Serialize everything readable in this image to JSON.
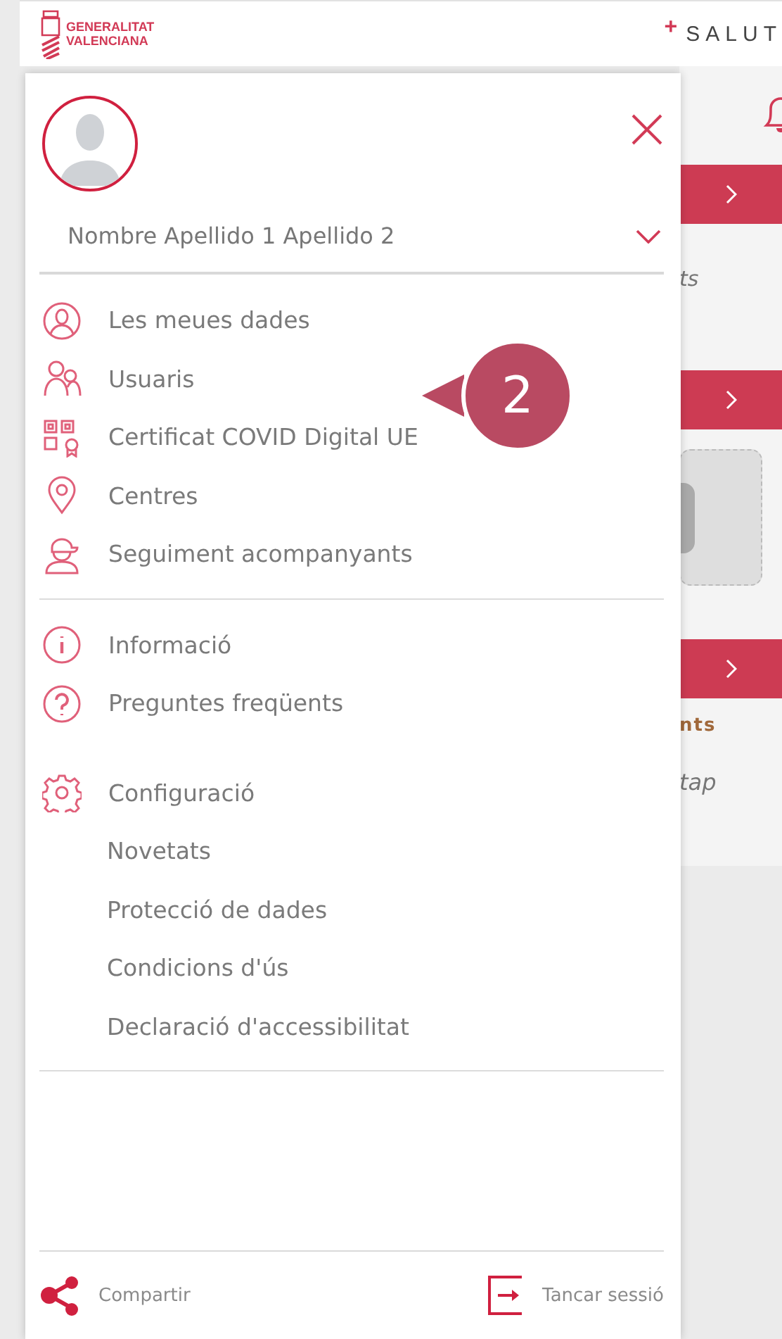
{
  "header": {
    "logo_lines": [
      "GENERALITAT",
      "VALENCIANA"
    ],
    "brand_mark": "+",
    "brand": "SALUT"
  },
  "background": [
    {
      "kind": "bar"
    },
    {
      "kind": "text",
      "text": "ts"
    },
    {
      "kind": "bar"
    },
    {
      "kind": "placeholder"
    },
    {
      "kind": "bar"
    },
    {
      "kind": "highlight",
      "text": "nts"
    },
    {
      "kind": "italic",
      "text": "tap"
    }
  ],
  "drawer": {
    "profile_name": "Nombre Apellido 1 Apellido 2",
    "sections": [
      [
        {
          "kind": "icon",
          "label": "Les meues dades"
        },
        {
          "kind": "icon",
          "label": "Usuaris"
        },
        {
          "kind": "icon",
          "label": "Certificat COVID Digital UE"
        },
        {
          "kind": "icon",
          "label": "Centres"
        },
        {
          "kind": "icon",
          "label": "Seguiment acompanyants"
        }
      ],
      [
        {
          "kind": "icon",
          "label": "Informació"
        },
        {
          "kind": "icon",
          "label": "Preguntes freqüents"
        }
      ],
      [
        {
          "kind": "icon",
          "label": "Configuració"
        },
        {
          "kind": "plain",
          "label": "Novetats"
        },
        {
          "kind": "plain",
          "label": "Protecció de dades"
        },
        {
          "kind": "plain",
          "label": "Condicions d'ús"
        },
        {
          "kind": "plain",
          "label": "Declaració d'accessibilitat"
        }
      ]
    ],
    "footer": {
      "share": "Compartir",
      "logout": "Tancar sessió"
    }
  },
  "callout": {
    "number": "2"
  }
}
